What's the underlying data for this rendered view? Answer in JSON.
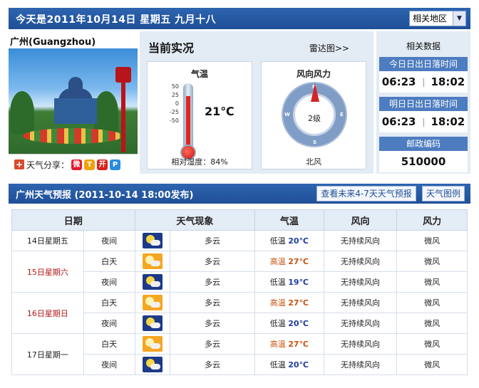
{
  "header": {
    "date_text": "今天是2011年10月14日  星期五  九月十八",
    "region_select": "相关地区"
  },
  "city": {
    "name": "广州(Guangzhou)",
    "share_label": "天气分享："
  },
  "realtime": {
    "title": "当前实况",
    "radar_link": "雷达图>>",
    "temp_card_title": "气温",
    "temp_scale": [
      "50",
      "25",
      "0",
      "-25",
      "-50"
    ],
    "temperature": "21℃",
    "temperature_value": 21,
    "humidity": "相对湿度：84%",
    "wind_card_title": "风向风力",
    "wind_level": "2级",
    "wind_direction": "北风",
    "compass_labels": {
      "n": "N",
      "s": "S",
      "e": "E",
      "w": "W"
    }
  },
  "related": {
    "title": "相关数据",
    "today_sun_head": "今日日出日落时间",
    "today_sunrise": "06:23",
    "today_sunset": "18:02",
    "tomorrow_sun_head": "明日日出日落时间",
    "tomorrow_sunrise": "06:23",
    "tomorrow_sunset": "18:02",
    "postcode_head": "邮政编码",
    "postcode": "510000"
  },
  "forecast": {
    "title": "广州天气预报 (2011-10-14  18:00发布)",
    "btn_more": "查看未来4-7天天气预报",
    "btn_legend": "天气图例",
    "columns": [
      "日期",
      "天气现象",
      "气温",
      "风向",
      "风力"
    ],
    "rows": [
      {
        "day": "14日星期五",
        "weekend": false,
        "periods": [
          {
            "period": "夜间",
            "icon": "night",
            "weather": "多云",
            "temp_label": "低温",
            "temp": "20℃",
            "wind_dir": "无持续风向",
            "wind_force": "微风"
          }
        ]
      },
      {
        "day": "15日星期六",
        "weekend": true,
        "periods": [
          {
            "period": "白天",
            "icon": "day",
            "weather": "多云",
            "temp_label": "高温",
            "temp": "27℃",
            "wind_dir": "无持续风向",
            "wind_force": "微风"
          },
          {
            "period": "夜间",
            "icon": "night",
            "weather": "多云",
            "temp_label": "低温",
            "temp": "19℃",
            "wind_dir": "无持续风向",
            "wind_force": "微风"
          }
        ]
      },
      {
        "day": "16日星期日",
        "weekend": true,
        "periods": [
          {
            "period": "白天",
            "icon": "day",
            "weather": "多云",
            "temp_label": "高温",
            "temp": "27℃",
            "wind_dir": "无持续风向",
            "wind_force": "微风"
          },
          {
            "period": "夜间",
            "icon": "night",
            "weather": "多云",
            "temp_label": "低温",
            "temp": "20℃",
            "wind_dir": "无持续风向",
            "wind_force": "微风"
          }
        ]
      },
      {
        "day": "17日星期一",
        "weekend": false,
        "periods": [
          {
            "period": "白天",
            "icon": "day",
            "weather": "多云",
            "temp_label": "高温",
            "temp": "27℃",
            "wind_dir": "无持续风向",
            "wind_force": "微风"
          },
          {
            "period": "夜间",
            "icon": "night",
            "weather": "多云",
            "temp_label": "低温",
            "temp": "20℃",
            "wind_dir": "无持续风向",
            "wind_force": "微风"
          }
        ]
      }
    ]
  }
}
